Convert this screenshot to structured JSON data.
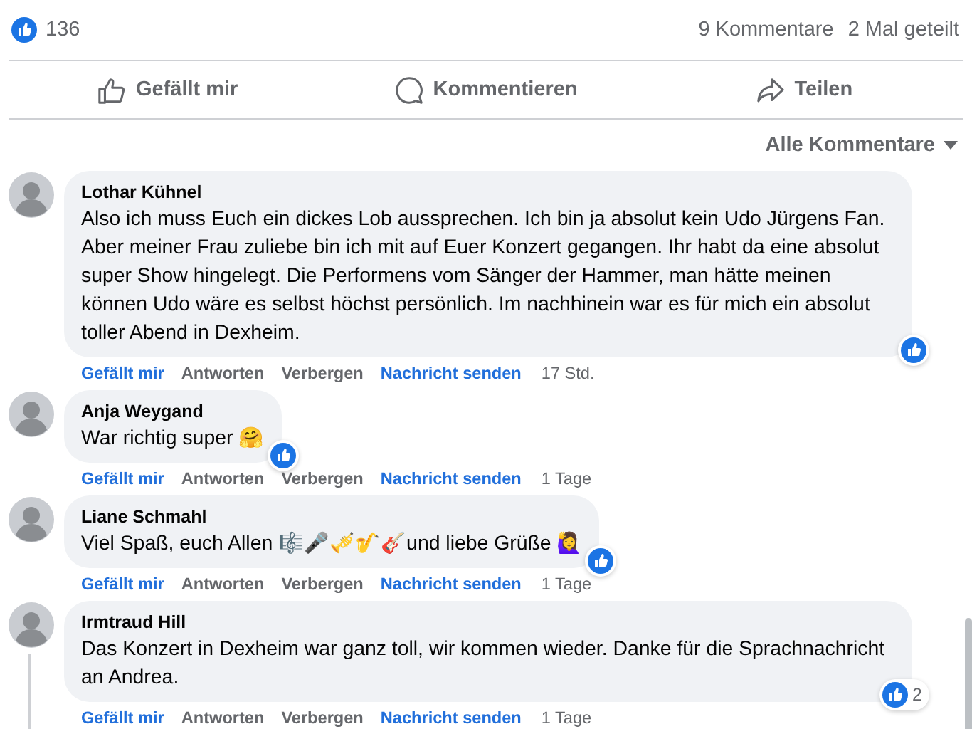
{
  "stats": {
    "likes": "136",
    "comments": "9 Kommentare",
    "shares": "2 Mal geteilt"
  },
  "actions": [
    {
      "kind": "like",
      "label": "Gefällt mir"
    },
    {
      "kind": "comment",
      "label": "Kommentieren"
    },
    {
      "kind": "share",
      "label": "Teilen"
    }
  ],
  "sort": {
    "label": "Alle Kommentare"
  },
  "comments": [
    {
      "author": "Lothar Kühnel",
      "text": "Also ich muss Euch ein dickes Lob aussprechen. Ich bin ja absolut kein Udo Jürgens Fan. Aber meiner Frau zuliebe bin ich mit auf Euer Konzert gegangen. Ihr habt da eine absolut super Show hingelegt. Die Performens vom Sänger der Hammer, man hätte meinen können Udo wäre es selbst höchst persönlich. Im nachhinein war es für mich ein absolut toller Abend in Dexheim.",
      "reaction": {
        "kind": "like"
      },
      "links": [
        "Gefällt mir",
        "Antworten",
        "Verbergen",
        "Nachricht senden"
      ],
      "time": "17 Std.",
      "thread": false
    },
    {
      "author": "Anja Weygand",
      "text": "War richtig super 🤗",
      "reaction": {
        "kind": "like"
      },
      "links": [
        "Gefällt mir",
        "Antworten",
        "Verbergen",
        "Nachricht senden"
      ],
      "time": "1 Tage",
      "thread": false
    },
    {
      "author": "Liane Schmahl",
      "text": "Viel Spaß, euch Allen 🎼🎤🎺🎷🎸und liebe Grüße 🙋‍♀️",
      "reaction": {
        "kind": "like"
      },
      "links": [
        "Gefällt mir",
        "Antworten",
        "Verbergen",
        "Nachricht senden"
      ],
      "time": "1 Tage",
      "thread": false
    },
    {
      "author": "Irmtraud Hill",
      "text": "Das Konzert in Dexheim war ganz toll, wir kommen wieder. Danke für die Sprachnachricht an Andrea.",
      "reaction": {
        "kind": "like",
        "count": "2"
      },
      "links": [
        "Gefällt mir",
        "Antworten",
        "Verbergen",
        "Nachricht senden"
      ],
      "time": "1 Tage",
      "thread": true
    }
  ]
}
